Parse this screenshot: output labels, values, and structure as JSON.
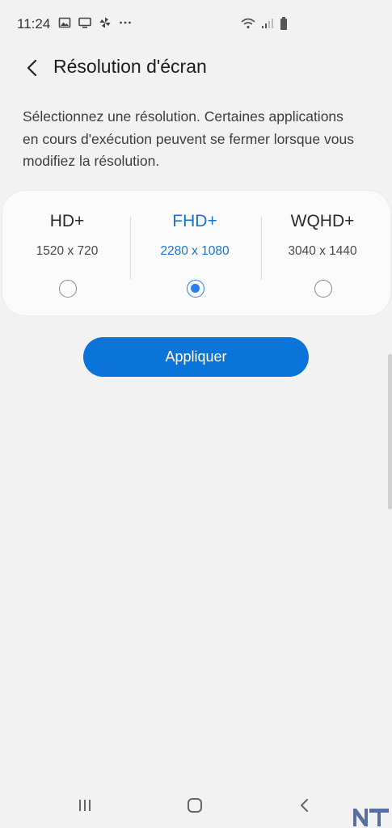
{
  "status_bar": {
    "time": "11:24",
    "left_icons": [
      "image-icon",
      "cast-screen-icon",
      "pinwheel-icon",
      "more-dots-icon"
    ],
    "right_icons": [
      "wifi-icon",
      "signal-icon",
      "battery-icon"
    ]
  },
  "header": {
    "title": "Résolution d'écran",
    "back_icon": "chevron-left-icon"
  },
  "description": "Sélectionnez une résolution. Certaines applications en cours d'exécution peuvent se fermer lorsque vous modifiez la résolution.",
  "options": [
    {
      "name": "HD+",
      "resolution": "1520 x 720",
      "selected": false
    },
    {
      "name": "FHD+",
      "resolution": "2280 x 1080",
      "selected": true
    },
    {
      "name": "WQHD+",
      "resolution": "3040 x 1440",
      "selected": false
    }
  ],
  "apply_label": "Appliquer",
  "nav_bar": {
    "icons": [
      "recent-apps-icon",
      "home-icon",
      "back-icon"
    ]
  },
  "colors": {
    "accent": "#0a74d8",
    "selected_text": "#1a73c9",
    "radio_selected": "#2a7ff0",
    "background": "#f2f2f2"
  }
}
